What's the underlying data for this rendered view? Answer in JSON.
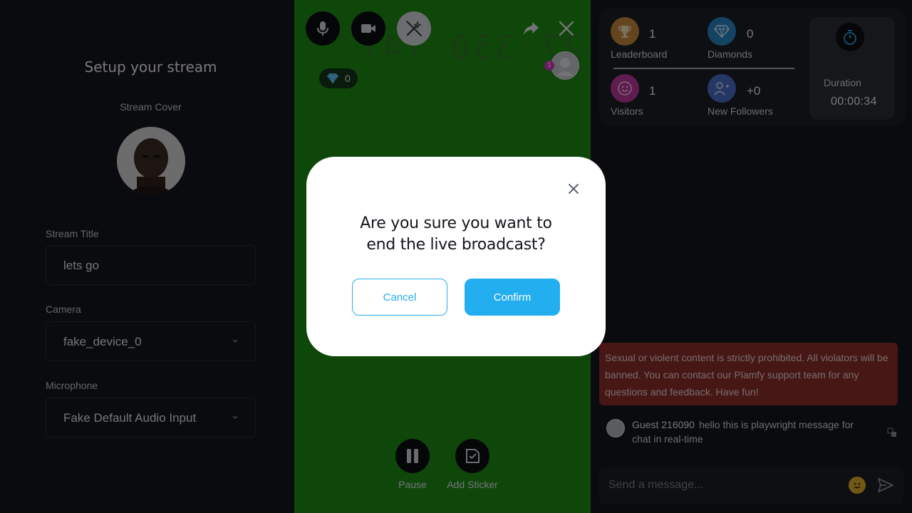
{
  "setup": {
    "title": "Setup your stream",
    "cover_label": "Stream Cover",
    "title_label": "Stream Title",
    "title_value": "lets go",
    "camera_label": "Camera",
    "camera_value": "fake_device_0",
    "mic_label": "Microphone",
    "mic_value": "Fake Default Audio Input"
  },
  "video": {
    "ghost_text": "27:350 747",
    "diamonds": "0",
    "viewer_count": "1",
    "pause_label": "Pause",
    "sticker_label": "Add Sticker"
  },
  "stats": {
    "leaderboard_value": "1",
    "leaderboard_label": "Leaderboard",
    "diamonds_value": "0",
    "diamonds_label": "Diamonds",
    "visitors_value": "1",
    "visitors_label": "Visitors",
    "followers_value": "+0",
    "followers_label": "New Followers",
    "duration_label": "Duration",
    "duration_value": "00:00:34"
  },
  "chat": {
    "rules": "Sexual or violent content is strictly prohibited. All violators will be banned. You can contact our Plamfy support team for any questions and feedback. Have fun!",
    "message_name": "Guest 216090",
    "message_text": "hello this is playwright message for chat in real-time",
    "input_placeholder": "Send a message..."
  },
  "modal": {
    "title": "Are you sure you want to end the live broadcast?",
    "cancel": "Cancel",
    "confirm": "Confirm"
  },
  "colors": {
    "accent": "#23aef0",
    "video_bg": "#1e8c14",
    "rules_bg": "#8e2e2b"
  }
}
